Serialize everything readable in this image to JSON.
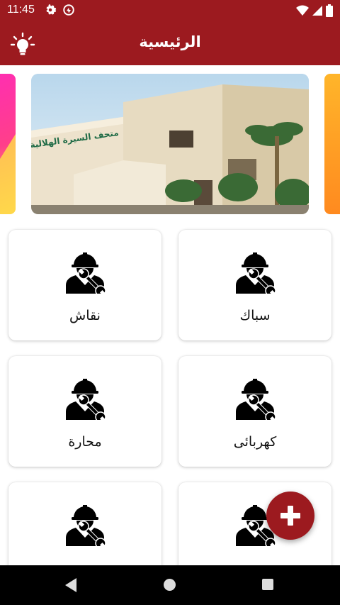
{
  "status_bar": {
    "time": "11:45"
  },
  "app_bar": {
    "title": "الرئيسية"
  },
  "services": [
    {
      "label": "سباك"
    },
    {
      "label": "نقاش"
    },
    {
      "label": "كهربائى"
    },
    {
      "label": "محارة"
    },
    {
      "label": ""
    },
    {
      "label": ""
    }
  ],
  "carousel": {
    "sign_text": "متحف السيرة الهلالية"
  },
  "colors": {
    "primary": "#9c1a1f",
    "background": "#ffffff",
    "card": "#ffffff"
  }
}
